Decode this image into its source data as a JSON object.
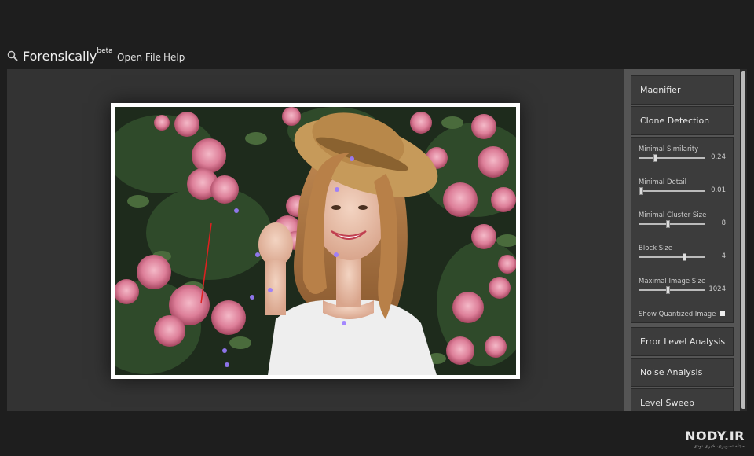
{
  "header": {
    "title": "Forensically",
    "title_sup": "beta",
    "menu": [
      "Open File",
      "Help"
    ]
  },
  "tools": {
    "magnifier": "Magnifier",
    "clone_detection": "Clone Detection",
    "error_level": "Error Level Analysis",
    "noise": "Noise Analysis",
    "level_sweep": "Level Sweep"
  },
  "clone_settings": [
    {
      "label": "Minimal Similarity",
      "value": "0.24",
      "level": 0.24
    },
    {
      "label": "Minimal Detail",
      "value": "0.01",
      "level": 0.01
    },
    {
      "label": "Minimal Cluster Size",
      "value": "8",
      "level": 0.44
    },
    {
      "label": "Block Size",
      "value": "4",
      "level": 0.7
    },
    {
      "label": "Maximal Image Size",
      "value": "1024",
      "level": 0.44
    }
  ],
  "show_quantized": {
    "label": "Show Quantized Image"
  },
  "watermark": {
    "main": "NODY.IR",
    "sub": "مجله تصویری، خبری نودی"
  },
  "colors": {
    "bg": "#1e1e1e",
    "workspace": "#333333",
    "panel": "#555555",
    "tool": "#3c3c3c",
    "clone_marker": "#9a7bff"
  }
}
